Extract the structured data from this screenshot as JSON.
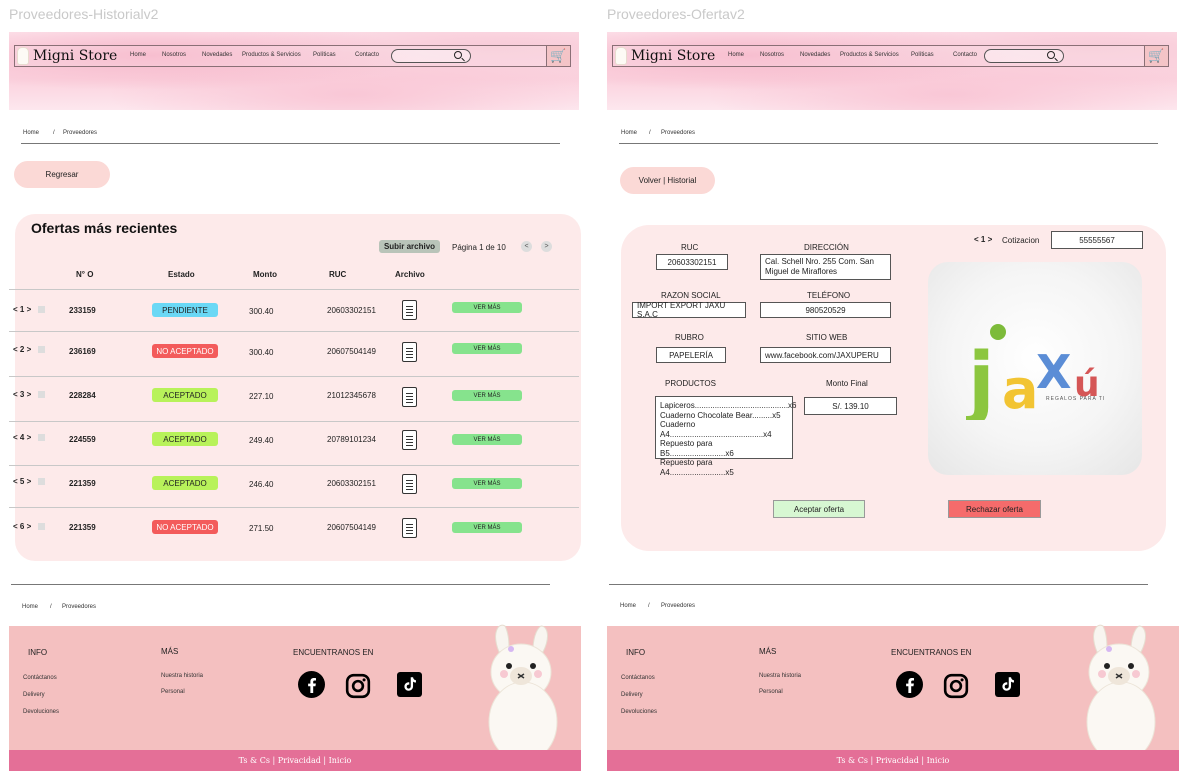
{
  "frames": {
    "left_title": "Proveedores-Historialv2",
    "right_title": "Proveedores-Ofertav2"
  },
  "header": {
    "brand": "Migni Store",
    "nav": [
      "Home",
      "Nosotros",
      "Novedades",
      "Productos & Servicios",
      "Políticas",
      "Contacto"
    ]
  },
  "breadcrumb": {
    "home": "Home",
    "sep": "/",
    "current": "Proveedores"
  },
  "historial": {
    "back_label": "Regresar",
    "title": "Ofertas más recientes",
    "upload_label": "Subir archivo",
    "pagination": "Página 1 de 10",
    "prev": "<",
    "next": ">",
    "columns": [
      "N° O",
      "Estado",
      "Monto",
      "RUC",
      "Archivo"
    ],
    "action_label": "VER MÁS",
    "rows": [
      {
        "idx": "< 1 >",
        "num": "233159",
        "status": "PENDIENTE",
        "kind": "pend",
        "amount": "300.40",
        "ruc": "20603302151"
      },
      {
        "idx": "< 2 >",
        "num": "236169",
        "status": "NO ACEPTADO",
        "kind": "no",
        "amount": "300.40",
        "ruc": "20607504149"
      },
      {
        "idx": "< 3 >",
        "num": "228284",
        "status": "ACEPTADO",
        "kind": "ok",
        "amount": "227.10",
        "ruc": "21012345678"
      },
      {
        "idx": "< 4 >",
        "num": "224559",
        "status": "ACEPTADO",
        "kind": "ok",
        "amount": "249.40",
        "ruc": "20789101234"
      },
      {
        "idx": "< 5 >",
        "num": "221359",
        "status": "ACEPTADO",
        "kind": "ok",
        "amount": "246.40",
        "ruc": "20603302151"
      },
      {
        "idx": "< 6 >",
        "num": "221359",
        "status": "NO ACEPTADO",
        "kind": "no",
        "amount": "271.50",
        "ruc": "20607504149"
      }
    ],
    "status_colors": {
      "pend": "#6ad8f5",
      "no": "#f35b5b",
      "ok": "#b8f25a"
    }
  },
  "oferta": {
    "back_label": "Volver | Historial",
    "index": "< 1 >",
    "cotizacion_label": "Cotizacion",
    "cotizacion_value": "55555567",
    "ruc_label": "RUC",
    "ruc_value": "20603302151",
    "direccion_label": "DIRECCIÓN",
    "direccion_value": "Cal. Schell Nro. 255 Com. San Miguel de Miraflores",
    "razon_label": "RAZON SOCIAL",
    "razon_value": "IMPORT EXPORT JAXU S.A.C",
    "telefono_label": "TELÉFONO",
    "telefono_value": "980520529",
    "rubro_label": "RUBRO",
    "rubro_value": "PAPELERÍA",
    "web_label": "SITIO WEB",
    "web_value": "www.facebook.com/JAXUPERU",
    "productos_label": "PRODUCTOS",
    "productos": [
      "Lapiceros..........................................x6",
      "Cuaderno Chocolate Bear.........x5",
      "Cuaderno A4..........................................x4",
      "Repuesto para B5.........................x6",
      "Repuesto para A4.........................x5"
    ],
    "monto_label": "Monto Final",
    "monto_value": "S/. 139.10",
    "logo_text": "jaXú",
    "logo_tagline": "REGALOS PARA TI",
    "accept_label": "Aceptar oferta",
    "reject_label": "Rechazar oferta",
    "accept_color": "#d7f7d2",
    "reject_color": "#f56b6b"
  },
  "footer": {
    "info_title": "INFO",
    "info_links": [
      "Contáctanos",
      "Delivery",
      "Devoluciones"
    ],
    "mas_title": "MÁS",
    "mas_links": [
      "Nuestra historia",
      "Personal"
    ],
    "social_title": "ENCUENTRANOS EN",
    "social": [
      "facebook-icon",
      "instagram-icon",
      "tiktok-icon"
    ],
    "bottom": "Ts & Cs |  Privacidad  | Inicio",
    "bg_color": "#f4c0c0",
    "bar_color": "#e46f97"
  }
}
